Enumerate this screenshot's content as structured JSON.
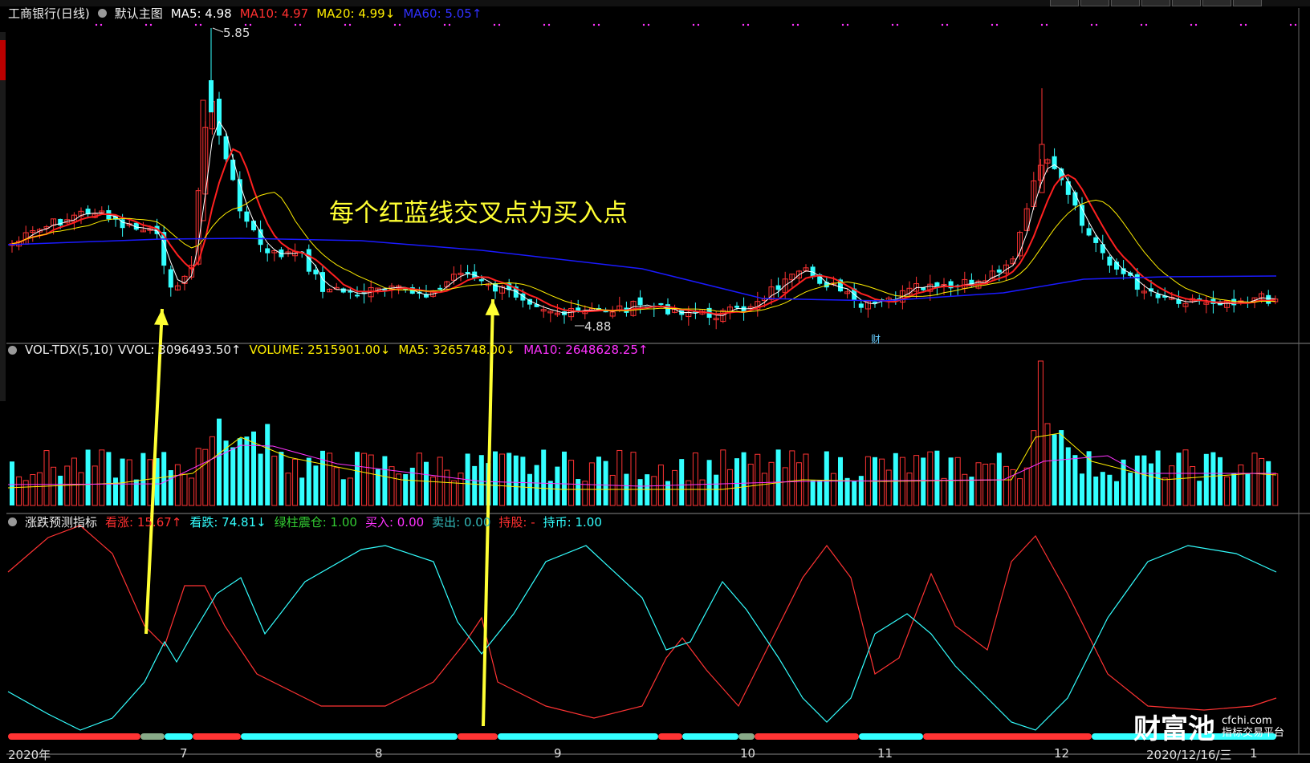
{
  "header_main": {
    "stock": "工商银行(日线)",
    "template": "默认主图",
    "ma5": "MA5: 4.98",
    "ma10": "MA10: 4.97",
    "ma20": "MA20: 4.99↓",
    "ma60": "MA60: 5.05↑"
  },
  "header_vol": {
    "name": "VOL-TDX(5,10)",
    "vvol": "VVOL: 3096493.50↑",
    "volume": "VOLUME: 2515901.00↓",
    "ma5": "MA5: 3265748.00↓",
    "ma10": "MA10: 2648628.25↑"
  },
  "header_ind": {
    "name": "涨跌预测指标",
    "up": "看涨: 15.67↑",
    "down": "看跌: 74.81↓",
    "green": "绿柱震仓: 1.00",
    "buy": "买入: 0.00",
    "sell": "卖出: 0.00",
    "hold_stock": "持股: -",
    "hold_cash": "持币: 1.00"
  },
  "price_labels": {
    "high": "5.85",
    "low": "4.88"
  },
  "annotation": "每个红蓝线交叉点为买入点",
  "marker_cai": "财",
  "x_axis": {
    "year": "2020年",
    "m7": "7",
    "m8": "8",
    "m9": "9",
    "m10": "10",
    "m11": "11",
    "m12": "12",
    "date": "2020/12/16/三",
    "m1": "1"
  },
  "logo": {
    "name": "财富池",
    "site": "cfchi.com",
    "tagline": "指标交易平台"
  },
  "colors": {
    "up": "#ff3333",
    "down": "#33ffff",
    "ma5": "#ffffff",
    "ma10": "#ff2020",
    "ma20": "#ffee00",
    "ma60": "#1a1aff",
    "arrow": "#ffff33"
  }
}
